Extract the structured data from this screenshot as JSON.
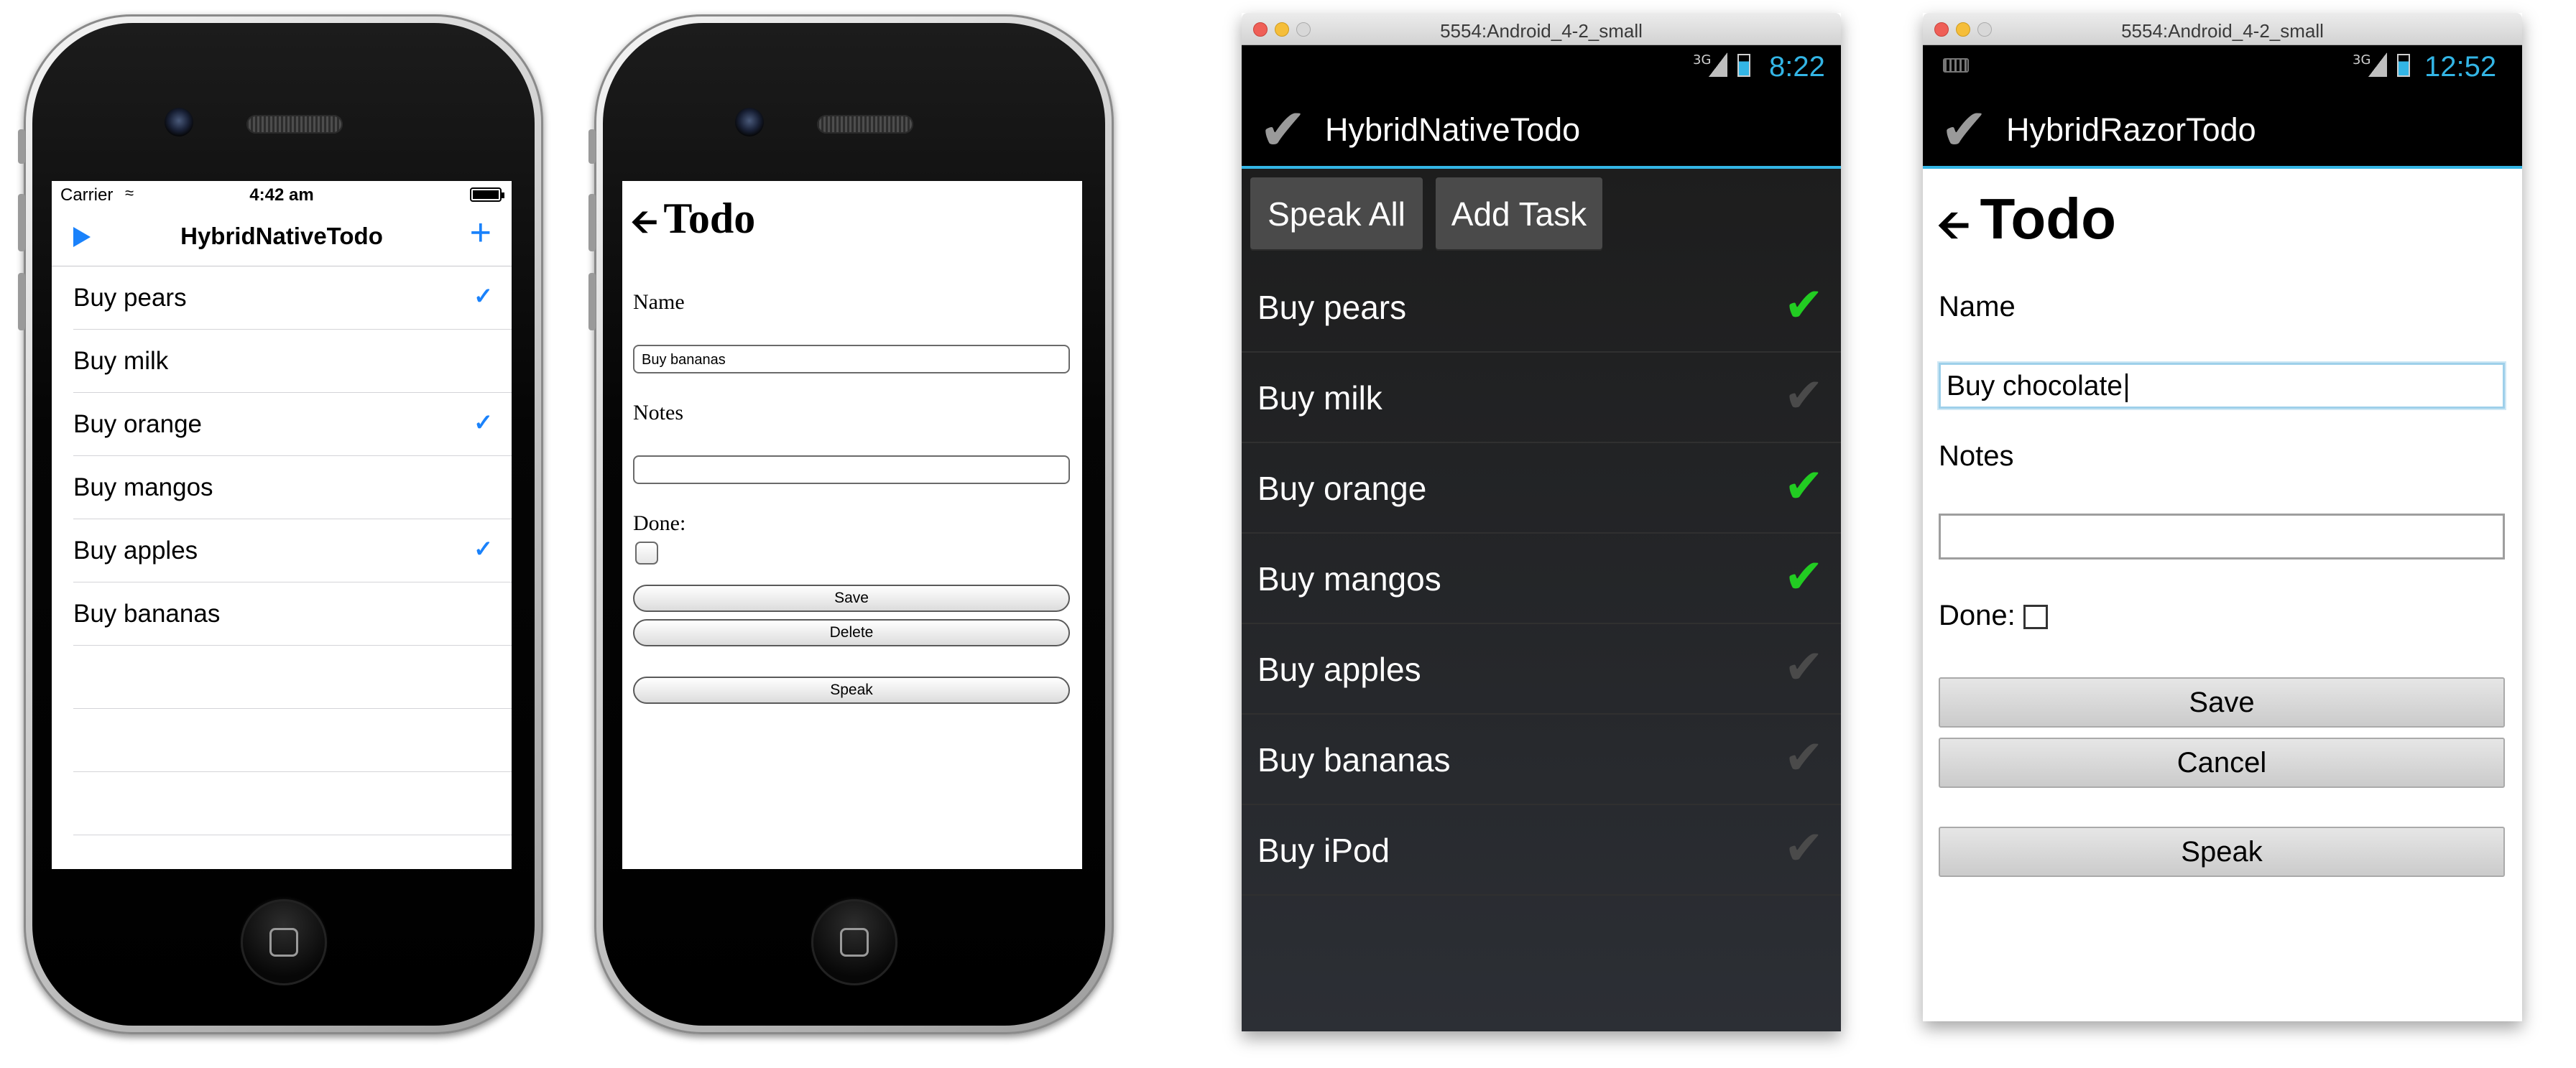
{
  "ios1": {
    "carrier": "Carrier",
    "time": "4:42 am",
    "title": "HybridNativeTodo",
    "play_icon": "play-icon",
    "add_icon": "plus-icon",
    "items": [
      {
        "label": "Buy pears",
        "done": true
      },
      {
        "label": "Buy milk",
        "done": false
      },
      {
        "label": "Buy orange",
        "done": true
      },
      {
        "label": "Buy mangos",
        "done": false
      },
      {
        "label": "Buy apples",
        "done": true
      },
      {
        "label": "Buy bananas",
        "done": false
      }
    ]
  },
  "ios2": {
    "title": "Todo",
    "name_label": "Name",
    "name_value": "Buy bananas",
    "notes_label": "Notes",
    "notes_value": "",
    "done_label": "Done:",
    "done_checked": false,
    "save": "Save",
    "delete": "Delete",
    "speak": "Speak"
  },
  "android1": {
    "window_title": "5554:Android_4-2_small",
    "network": "3G",
    "time": "8:22",
    "title": "HybridNativeTodo",
    "speak_all": "Speak All",
    "add_task": "Add Task",
    "items": [
      {
        "label": "Buy pears",
        "done": true
      },
      {
        "label": "Buy milk",
        "done": false
      },
      {
        "label": "Buy orange",
        "done": true
      },
      {
        "label": "Buy mangos",
        "done": true
      },
      {
        "label": "Buy apples",
        "done": false
      },
      {
        "label": "Buy bananas",
        "done": false
      },
      {
        "label": "Buy iPod",
        "done": false
      }
    ]
  },
  "android2": {
    "window_title": "5554:Android_4-2_small",
    "network": "3G",
    "time": "12:52",
    "title": "HybridRazorTodo",
    "page_title": "Todo",
    "name_label": "Name",
    "name_value": "Buy chocolate",
    "notes_label": "Notes",
    "notes_value": "",
    "done_label": "Done:",
    "done_checked": false,
    "save": "Save",
    "cancel": "Cancel",
    "speak": "Speak"
  },
  "colors": {
    "ios_accent": "#1a82fb",
    "android_accent": "#33b5e5",
    "android_check_on": "#22cc22"
  }
}
